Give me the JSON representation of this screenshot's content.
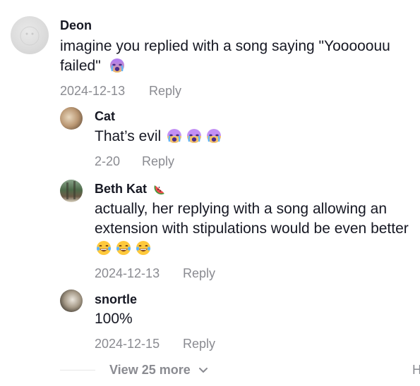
{
  "comments": [
    {
      "user": "Deon",
      "text": "imagine you replied with a song saying \"Yooooouu failed\"",
      "emoji_after": "crying-face",
      "date": "2024-12-13",
      "reply_label": "Reply"
    }
  ],
  "replies": [
    {
      "user": "Cat",
      "text": "That’s evil",
      "emojis": [
        "crying-face",
        "crying-face",
        "crying-face"
      ],
      "date": "2-20",
      "reply_label": "Reply"
    },
    {
      "user": "Beth Kat",
      "name_emoji": "watermelon",
      "text": "actually, her replying with a song allowing an extension with stipulations would be even better",
      "emojis": [
        "laughing-tears",
        "laughing-tears",
        "laughing-tears"
      ],
      "date": "2024-12-13",
      "reply_label": "Reply"
    },
    {
      "user": "snortle",
      "text": "100%",
      "date": "2024-12-15",
      "reply_label": "Reply"
    }
  ],
  "view_more": "View 25 more",
  "cut_off_text": "H"
}
